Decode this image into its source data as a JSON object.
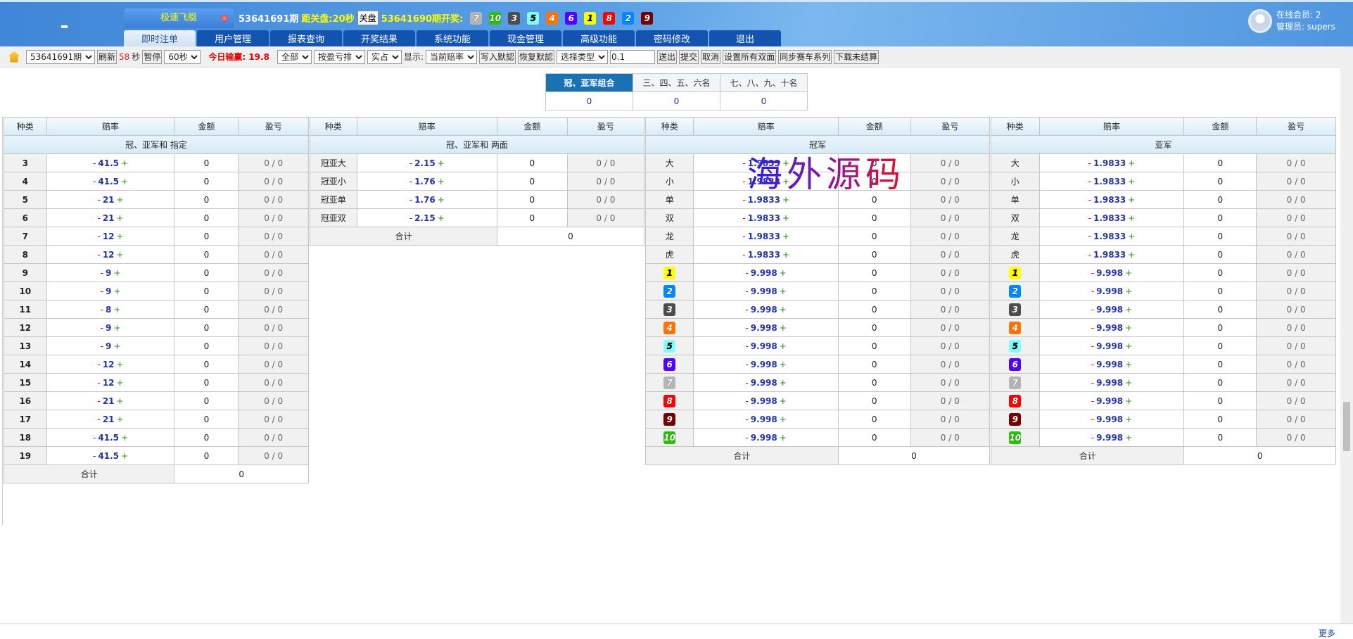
{
  "header": {
    "game_name": "极速飞艇",
    "current_issue": "53641691期",
    "close_countdown_label": "距关盘:20秒",
    "close_button": "关盘",
    "last_issue_label": "53641690期开奖:",
    "last_result": [
      7,
      10,
      3,
      5,
      4,
      6,
      1,
      8,
      2,
      9
    ],
    "online_members": "在线会员: 2",
    "admin": "管理员: supers"
  },
  "nav": [
    "即时注单",
    "用户管理",
    "报表查询",
    "开奖结果",
    "系统功能",
    "现金管理",
    "高级功能",
    "密码修改",
    "退出"
  ],
  "toolbar": {
    "issue_select": "53641691期",
    "refresh": "刷新",
    "countdown": "58",
    "seconds": "秒",
    "pause": "暂停",
    "interval": "60秒",
    "today_label": "今日输赢:",
    "today_value": "19.8",
    "scope": "全部",
    "sort": "按盈亏排",
    "mode": "实占",
    "display_label": "显示:",
    "display_select": "当前赔率",
    "write_default": "写入默認",
    "restore_default": "恢复默認",
    "type_select": "选择类型",
    "step_value": "0.1",
    "send": "送出",
    "submit": "提交",
    "cancel": "取消",
    "set_all": "设置所有双面",
    "sync": "同步赛车系列",
    "download": "下载未结算"
  },
  "summary": {
    "tabs": [
      "冠、亚军组合",
      "三、四、五、六名",
      "七、八、九、十名"
    ],
    "values": [
      "0",
      "0",
      "0"
    ]
  },
  "columns": [
    "种类",
    "赔率",
    "金额",
    "盈亏"
  ],
  "total_label": "合计",
  "tables": [
    {
      "title": "冠、亚军和 指定",
      "total": "0",
      "rows": [
        [
          "3",
          "41.5"
        ],
        [
          "4",
          "41.5"
        ],
        [
          "5",
          "21"
        ],
        [
          "6",
          "21"
        ],
        [
          "7",
          "12"
        ],
        [
          "8",
          "12"
        ],
        [
          "9",
          "9"
        ],
        [
          "10",
          "9"
        ],
        [
          "11",
          "8"
        ],
        [
          "12",
          "9"
        ],
        [
          "13",
          "9"
        ],
        [
          "14",
          "12"
        ],
        [
          "15",
          "12"
        ],
        [
          "16",
          "21"
        ],
        [
          "17",
          "21"
        ],
        [
          "18",
          "41.5"
        ],
        [
          "19",
          "41.5"
        ]
      ]
    },
    {
      "title": "冠、亚军和 两面",
      "total": "0",
      "rows": [
        [
          "冠亚大",
          "2.15"
        ],
        [
          "冠亚小",
          "1.76"
        ],
        [
          "冠亚单",
          "1.76"
        ],
        [
          "冠亚双",
          "2.15"
        ]
      ]
    },
    {
      "title": "冠军",
      "total": "0",
      "rows": [
        [
          "大",
          "1.9833"
        ],
        [
          "小",
          "1.9833"
        ],
        [
          "单",
          "1.9833"
        ],
        [
          "双",
          "1.9833"
        ],
        [
          "龙",
          "1.9833"
        ],
        [
          "虎",
          "1.9833"
        ],
        [
          "1",
          "9.998"
        ],
        [
          "2",
          "9.998"
        ],
        [
          "3",
          "9.998"
        ],
        [
          "4",
          "9.998"
        ],
        [
          "5",
          "9.998"
        ],
        [
          "6",
          "9.998"
        ],
        [
          "7",
          "9.998"
        ],
        [
          "8",
          "9.998"
        ],
        [
          "9",
          "9.998"
        ],
        [
          "10",
          "9.998"
        ]
      ]
    },
    {
      "title": "亚军",
      "total": "0",
      "rows": [
        [
          "大",
          "1.9833"
        ],
        [
          "小",
          "1.9833"
        ],
        [
          "单",
          "1.9833"
        ],
        [
          "双",
          "1.9833"
        ],
        [
          "龙",
          "1.9833"
        ],
        [
          "虎",
          "1.9833"
        ],
        [
          "1",
          "9.998"
        ],
        [
          "2",
          "9.998"
        ],
        [
          "3",
          "9.998"
        ],
        [
          "4",
          "9.998"
        ],
        [
          "5",
          "9.998"
        ],
        [
          "6",
          "9.998"
        ],
        [
          "7",
          "9.998"
        ],
        [
          "8",
          "9.998"
        ],
        [
          "9",
          "9.998"
        ],
        [
          "10",
          "9.998"
        ]
      ]
    }
  ],
  "row_amount": "0",
  "row_profit": "0 / 0",
  "watermark": "海外源码",
  "footer": {
    "more": "更多"
  }
}
